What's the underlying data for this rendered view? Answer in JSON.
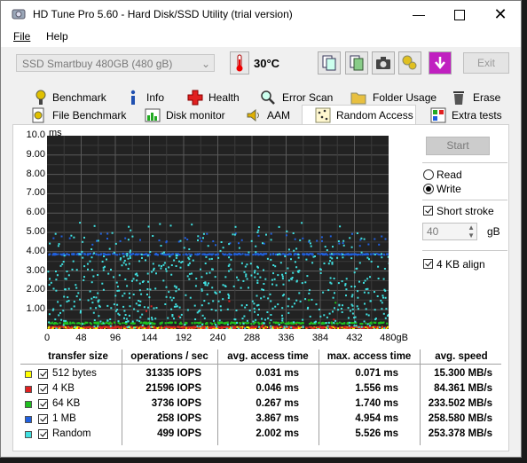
{
  "window": {
    "title": "HD Tune Pro 5.60 - Hard Disk/SSD Utility (trial version)"
  },
  "menu": {
    "file": "File",
    "help": "Help"
  },
  "toolbar": {
    "drive": "SSD Smartbuy 480GB (480 gB)",
    "temperature": "30°C",
    "exit_label": "Exit"
  },
  "tabs_row1": [
    {
      "label": "Benchmark",
      "icon": "benchmark-icon"
    },
    {
      "label": "Info",
      "icon": "info-icon"
    },
    {
      "label": "Health",
      "icon": "health-icon"
    },
    {
      "label": "Error Scan",
      "icon": "error-scan-icon"
    },
    {
      "label": "Folder Usage",
      "icon": "folder-icon"
    },
    {
      "label": "Erase",
      "icon": "erase-icon"
    }
  ],
  "tabs_row2": [
    {
      "label": "File Benchmark",
      "icon": "file-benchmark-icon"
    },
    {
      "label": "Disk monitor",
      "icon": "disk-monitor-icon"
    },
    {
      "label": "AAM",
      "icon": "aam-icon"
    },
    {
      "label": "Random Access",
      "icon": "random-access-icon",
      "active": true
    },
    {
      "label": "Extra tests",
      "icon": "extra-tests-icon"
    }
  ],
  "controls": {
    "start_label": "Start",
    "read_label": "Read",
    "write_label": "Write",
    "mode": "Write",
    "short_stroke_label": "Short stroke",
    "short_stroke_checked": false,
    "short_stroke_value": "40",
    "short_stroke_unit": "gB",
    "align_label": "4 KB align",
    "align_checked": true
  },
  "chart_data": {
    "type": "scatter",
    "ylabel": "ms",
    "xlabel": "",
    "x_unit": "gB",
    "ylim": [
      0,
      10
    ],
    "xlim": [
      0,
      480
    ],
    "y_ticks": [
      "1.00",
      "2.00",
      "3.00",
      "4.00",
      "5.00",
      "6.00",
      "7.00",
      "8.00",
      "9.00",
      "10.0"
    ],
    "x_ticks": [
      "0",
      "48",
      "96",
      "144",
      "192",
      "240",
      "288",
      "336",
      "384",
      "432",
      "480gB"
    ],
    "grid": true,
    "background": "#222222",
    "series": [
      {
        "name": "512 bytes",
        "color": "#ffff00",
        "typical_ms": 0.031,
        "max_ms": 0.071
      },
      {
        "name": "4 KB",
        "color": "#e02020",
        "typical_ms": 0.046,
        "max_ms": 1.556
      },
      {
        "name": "64 KB",
        "color": "#20c020",
        "typical_ms": 0.267,
        "max_ms": 1.74
      },
      {
        "name": "1 MB",
        "color": "#2060e0",
        "typical_ms": 3.867,
        "max_ms": 4.954
      },
      {
        "name": "Random",
        "color": "#40e0e0",
        "typical_ms": 2.002,
        "max_ms": 5.526
      }
    ]
  },
  "results": {
    "headers": [
      "transfer size",
      "operations / sec",
      "avg. access time",
      "max. access time",
      "avg. speed"
    ],
    "rows": [
      {
        "size": "512 bytes",
        "color": "#ffff00",
        "ops": "31335 IOPS",
        "avg": "0.031 ms",
        "max": "0.071 ms",
        "speed": "15.300 MB/s"
      },
      {
        "size": "4 KB",
        "color": "#e02020",
        "ops": "21596 IOPS",
        "avg": "0.046 ms",
        "max": "1.556 ms",
        "speed": "84.361 MB/s"
      },
      {
        "size": "64 KB",
        "color": "#20c020",
        "ops": "3736 IOPS",
        "avg": "0.267 ms",
        "max": "1.740 ms",
        "speed": "233.502 MB/s"
      },
      {
        "size": "1 MB",
        "color": "#2060e0",
        "ops": "258 IOPS",
        "avg": "3.867 ms",
        "max": "4.954 ms",
        "speed": "258.580 MB/s"
      },
      {
        "size": "Random",
        "color": "#40e0e0",
        "ops": "499 IOPS",
        "avg": "2.002 ms",
        "max": "5.526 ms",
        "speed": "253.378 MB/s"
      }
    ]
  }
}
